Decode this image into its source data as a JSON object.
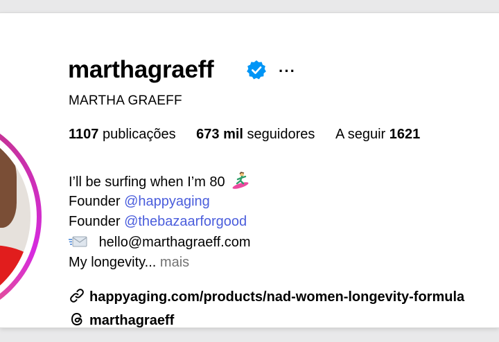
{
  "profile": {
    "username": "marthagraeff",
    "verified": true,
    "more_label": "···",
    "full_name": "MARTHA GRAEFF"
  },
  "stats": {
    "posts_value": "1107",
    "posts_label": "publicações",
    "followers_value": "673 mil",
    "followers_label": "seguidores",
    "following_label": "A seguir",
    "following_value": "1621"
  },
  "bio": {
    "line1": "I’ll be surfing when I’m 80",
    "line2_prefix": "Founder",
    "line2_mention": "@happyaging",
    "line3_prefix": "Founder",
    "line3_mention": "@thebazaarforgood",
    "line4_email": "hello@marthagraeff.com",
    "line5_text": "My longevity...",
    "more": "mais"
  },
  "website": "happyaging.com/products/nad-women-longevity-formula",
  "threads_handle": "marthagraeff",
  "colors": {
    "verified_blue": "#0095f6",
    "mention_blue": "#4a5ddc",
    "muted_gray": "#737373",
    "ring_gradient": [
      "#f58529",
      "#dd2a7b",
      "#c13584"
    ]
  }
}
